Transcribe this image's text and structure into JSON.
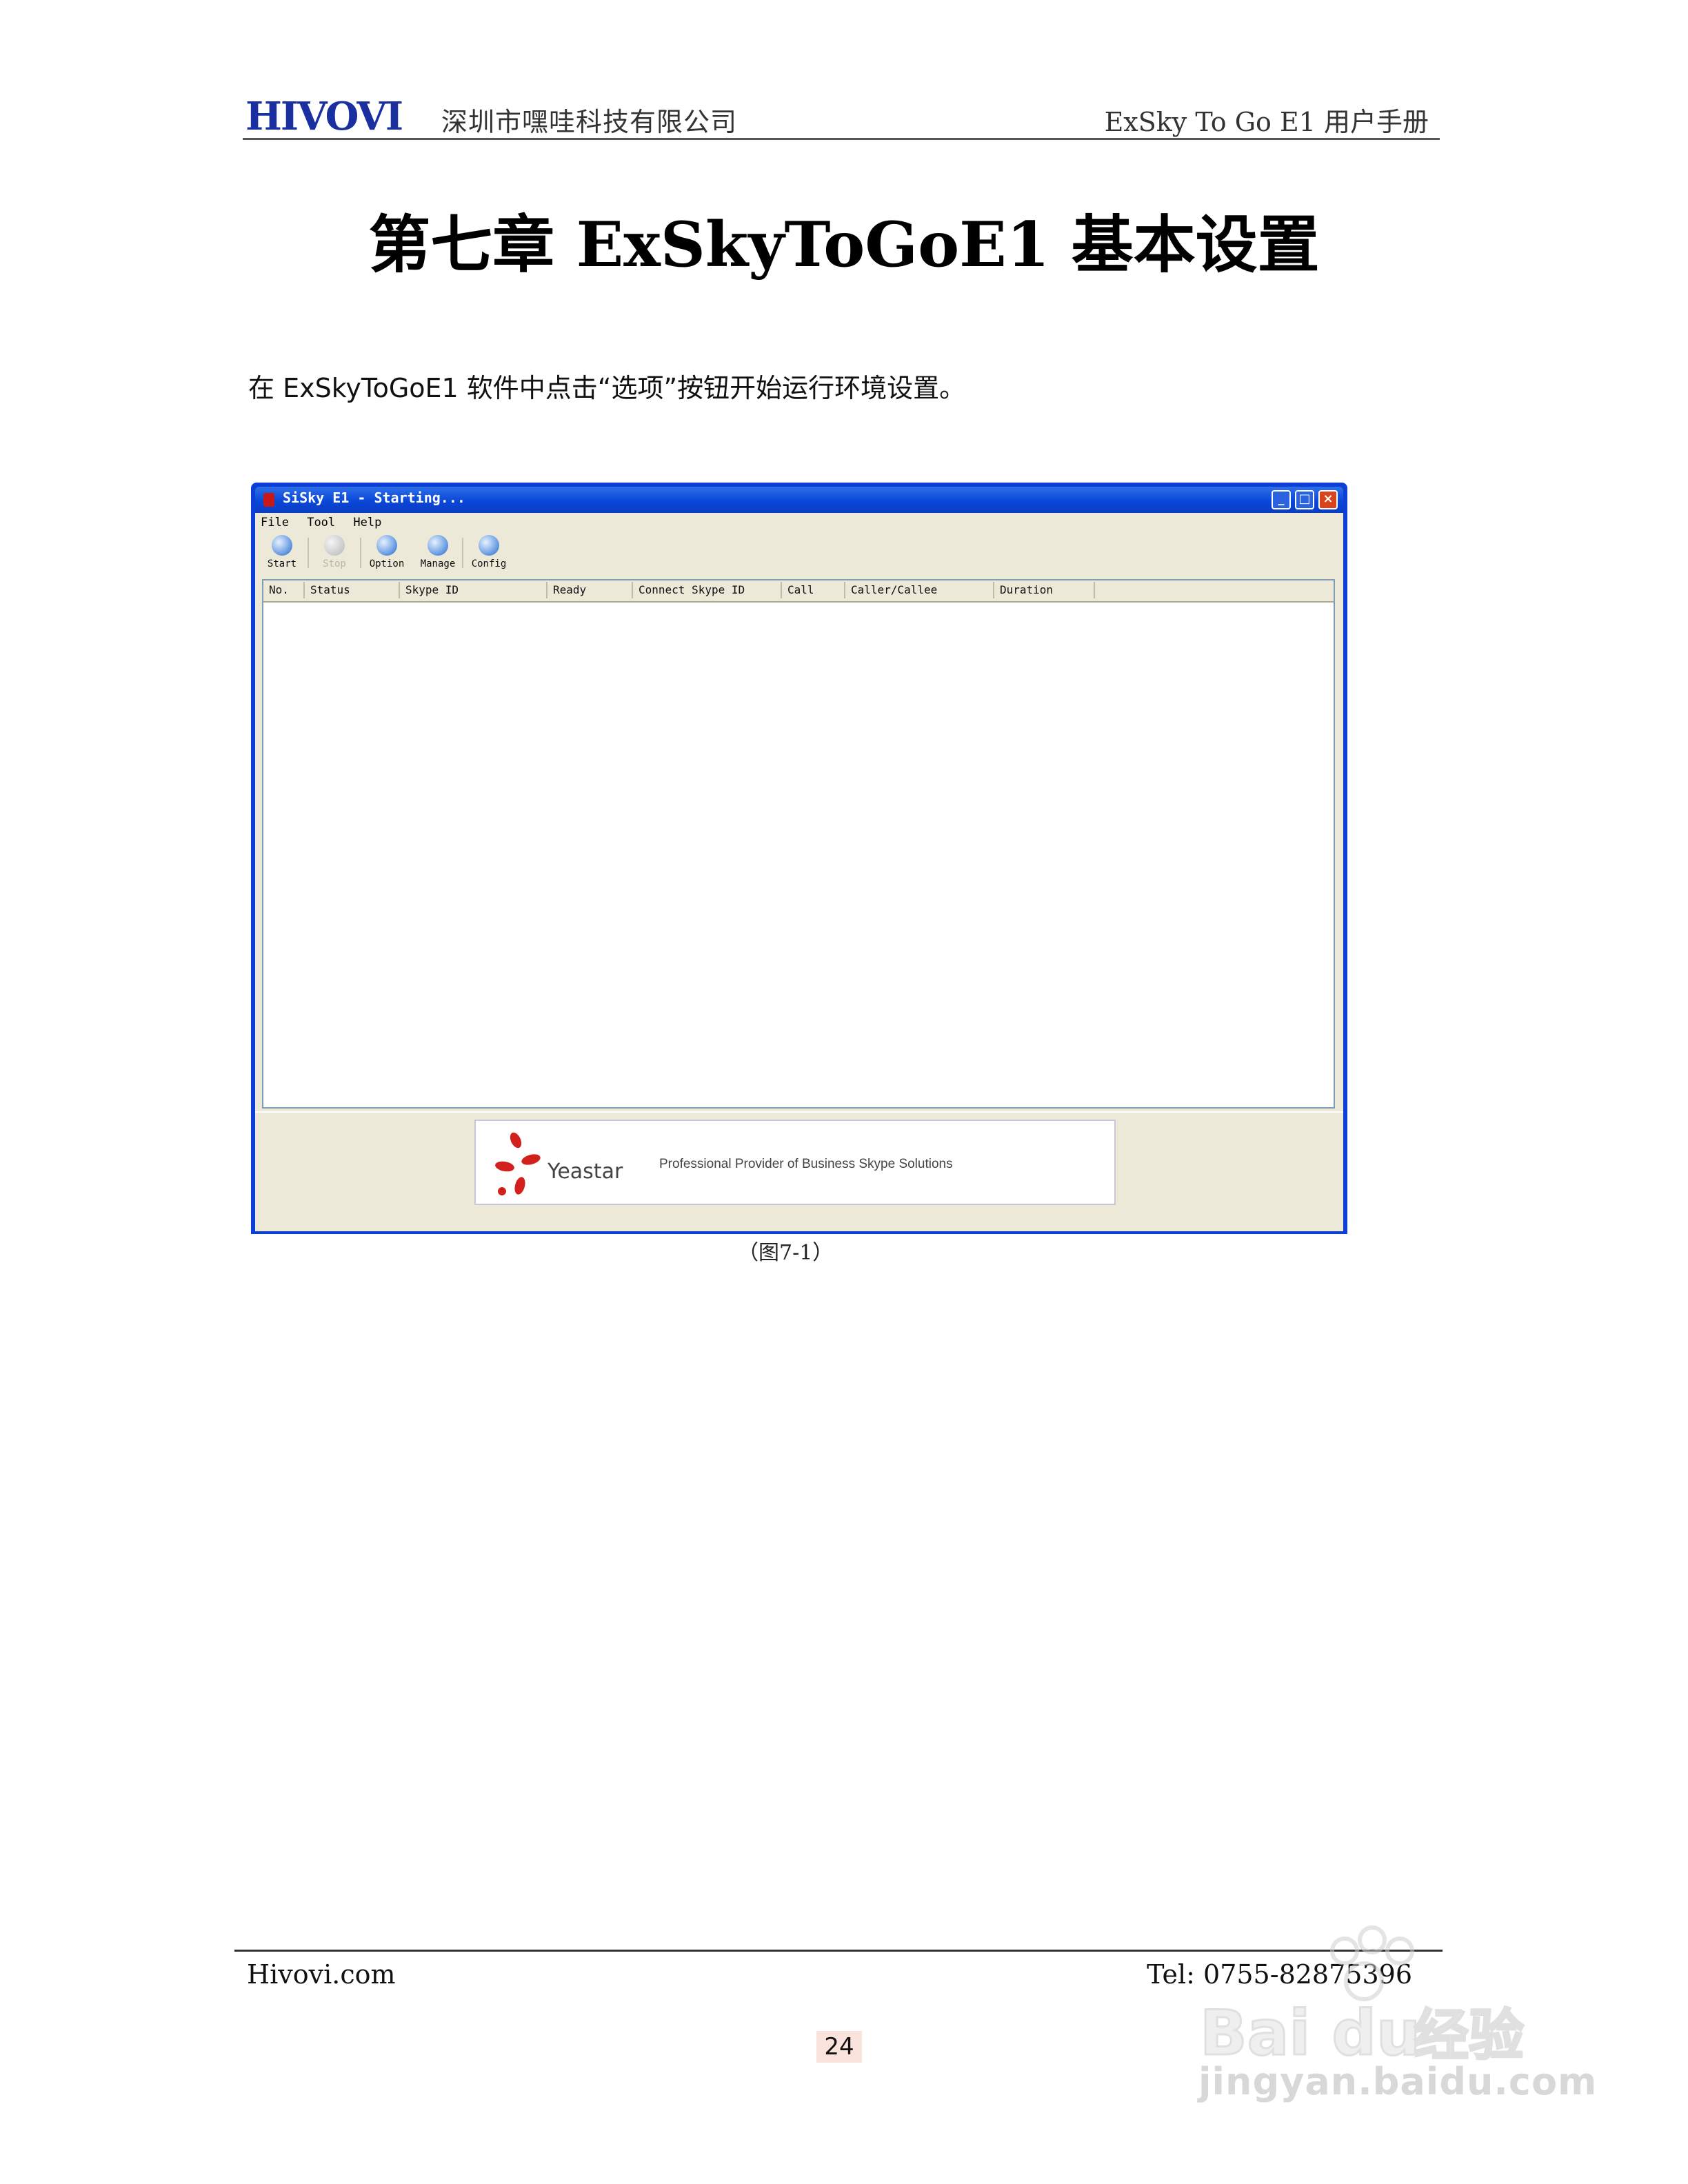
{
  "header": {
    "logo_text": "HIVOVI",
    "company": "深圳市嘿哇科技有限公司",
    "manual": "ExSky To Go E1 用户手册"
  },
  "title": "第七章 ExSkyToGoE1 基本设置",
  "intro": "在 ExSkyToGoE1 软件中点击“选项”按钮开始运行环境设置。",
  "screenshot": {
    "window_title": "SiSky E1 - Starting...",
    "window_buttons": {
      "minimize": "_",
      "maximize": "□",
      "close": "×"
    },
    "menu": [
      "File",
      "Tool",
      "Help"
    ],
    "toolbar": [
      {
        "label": "Start",
        "icon": "start-icon",
        "enabled": true
      },
      {
        "label": "Stop",
        "icon": "stop-icon",
        "enabled": false
      },
      {
        "label": "Option",
        "icon": "option-icon",
        "enabled": true
      },
      {
        "label": "Manage",
        "icon": "manage-icon",
        "enabled": true
      },
      {
        "label": "Config",
        "icon": "config-icon",
        "enabled": true
      }
    ],
    "columns": [
      "No.",
      "Status",
      "Skype ID",
      "Ready",
      "Connect Skype ID",
      "Call",
      "Caller/Callee",
      "Duration"
    ],
    "banner": {
      "brand": "Yeastar",
      "tagline": "Professional Provider of Business Skype Solutions",
      "logo_color": "#d2211c"
    }
  },
  "caption": "（图7-1）",
  "footer": {
    "site": "Hivovi.com",
    "tel": "Tel:  0755-82875396",
    "page": "24"
  },
  "watermark": {
    "text": "jingyan.baidu.com",
    "brand": "Baidu经验"
  },
  "colors": {
    "logo_blue": "#1a2fa0",
    "window_blue": "#0b3fd6",
    "window_face": "#ece9d8"
  }
}
